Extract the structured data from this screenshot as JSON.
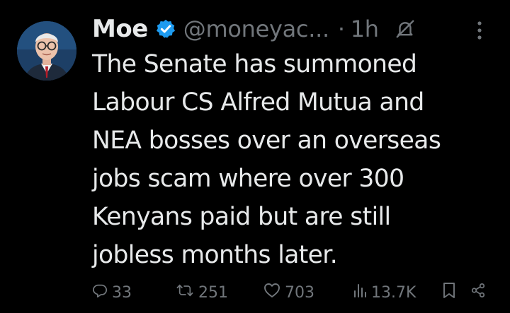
{
  "tweet": {
    "author_name": "Moe",
    "handle": "@moneyac...",
    "separator": "·",
    "time": "1h",
    "text_lines": [
      "The Senate has summoned",
      "Labour CS Alfred Mutua and",
      "NEA bosses over an overseas",
      "jobs scam where over 300",
      "Kenyans paid but are still",
      "jobless months later."
    ],
    "stats": {
      "replies": "33",
      "reposts": "251",
      "likes": "703",
      "views": "13.7K"
    }
  },
  "icons": {
    "verified": "verified-badge-icon",
    "mute": "muted-bell-icon",
    "more": "more-vertical-icon",
    "reply": "reply-icon",
    "repost": "repost-icon",
    "like": "heart-icon",
    "views": "views-chart-icon",
    "bookmark": "bookmark-icon",
    "share": "share-icon"
  },
  "colors": {
    "background": "#000000",
    "text_primary": "#e7e9ea",
    "text_secondary": "#71767b",
    "verified_blue": "#1d9bf0"
  }
}
